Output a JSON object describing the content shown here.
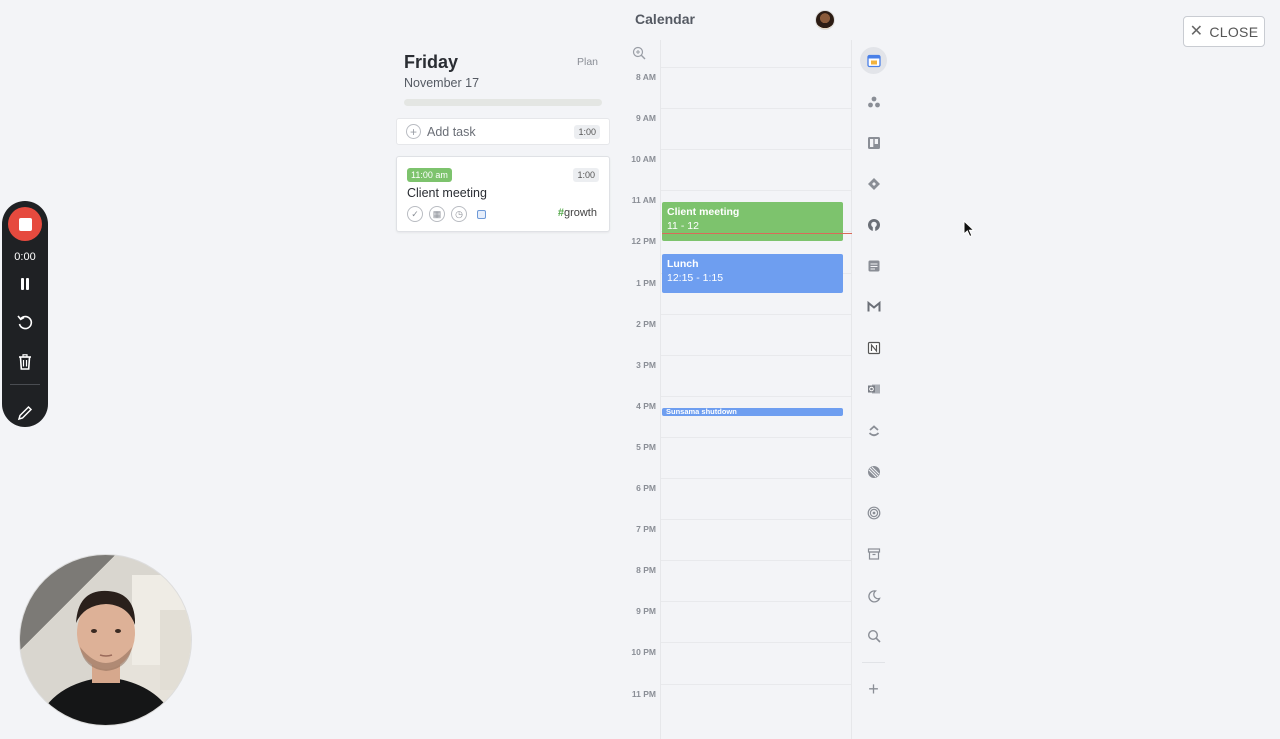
{
  "header": {
    "title": "Calendar",
    "close_label": "CLOSE"
  },
  "day": {
    "weekday": "Friday",
    "date": "November 17",
    "plan_label": "Plan"
  },
  "add_task": {
    "label": "Add task",
    "duration": "1:00"
  },
  "task": {
    "time": "11:00 am",
    "duration": "1:00",
    "title": "Client meeting",
    "tag": "growth",
    "tag_prefix": "#"
  },
  "calendar": {
    "hours": [
      "8 AM",
      "9 AM",
      "10 AM",
      "11 AM",
      "12 PM",
      "1 PM",
      "2 PM",
      "3 PM",
      "4 PM",
      "5 PM",
      "6 PM",
      "7 PM",
      "8 PM",
      "9 PM",
      "10 PM",
      "11 PM"
    ],
    "events": {
      "client_meeting": {
        "title": "Client meeting",
        "time": "11 - 12"
      },
      "lunch": {
        "title": "Lunch",
        "time": "12:15 - 1:15"
      },
      "shutdown": {
        "title": "Sunsama shutdown"
      }
    }
  },
  "rail": {
    "items": [
      "calendar-icon",
      "asana-icon",
      "trello-icon",
      "jira-icon",
      "github-icon",
      "notes-icon",
      "gmail-icon",
      "notion-icon",
      "outlook-icon",
      "clickup-icon",
      "linear-icon",
      "target-icon",
      "archive-icon",
      "moon-icon",
      "search-icon"
    ],
    "add_label": "+"
  },
  "recorder": {
    "time": "0:00"
  },
  "colors": {
    "event_green": "#7dc36d",
    "event_blue": "#6e9ef0",
    "record_red": "#e64a3e",
    "now_line": "#d96a5a"
  }
}
